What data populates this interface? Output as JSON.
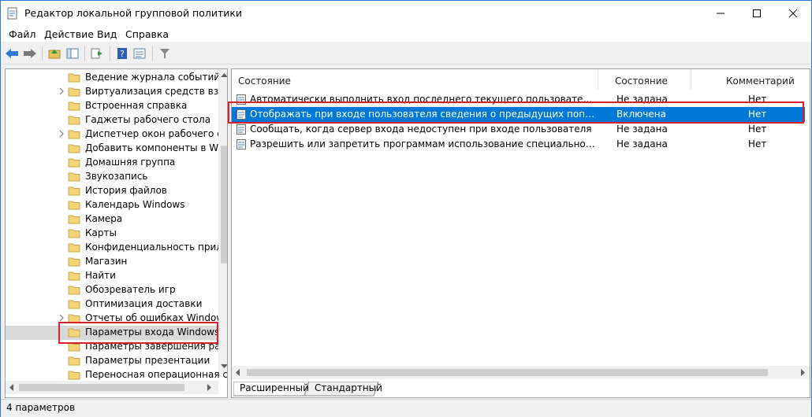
{
  "window": {
    "title": "Редактор локальной групповой политики"
  },
  "menu": [
    "Файл",
    "Действие",
    "Вид",
    "Справка"
  ],
  "tree": {
    "items": [
      {
        "label": "Ведение журнала событий",
        "expandable": false
      },
      {
        "label": "Виртуализация средств взаим",
        "expandable": true
      },
      {
        "label": "Встроенная справка",
        "expandable": false
      },
      {
        "label": "Гаджеты рабочего стола",
        "expandable": false
      },
      {
        "label": "Диспетчер окон рабочего стс",
        "expandable": true
      },
      {
        "label": "Добавить компоненты в Winc",
        "expandable": false
      },
      {
        "label": "Домашняя группа",
        "expandable": false
      },
      {
        "label": "Звукозапись",
        "expandable": false
      },
      {
        "label": "История файлов",
        "expandable": false
      },
      {
        "label": "Календарь Windows",
        "expandable": false
      },
      {
        "label": "Камера",
        "expandable": false
      },
      {
        "label": "Карты",
        "expandable": false
      },
      {
        "label": "Конфиденциальность прилож",
        "expandable": false
      },
      {
        "label": "Магазин",
        "expandable": false
      },
      {
        "label": "Найти",
        "expandable": false
      },
      {
        "label": "Обозреватель игр",
        "expandable": false
      },
      {
        "label": "Оптимизация доставки",
        "expandable": false
      },
      {
        "label": "Отчеты об ошибках Windows",
        "expandable": true
      },
      {
        "label": "Параметры входа Windows",
        "expandable": false,
        "selected": true
      },
      {
        "label": "Параметры завершения рабо",
        "expandable": false
      },
      {
        "label": "Параметры презентации",
        "expandable": false
      },
      {
        "label": "Переносная операционная с",
        "expandable": false
      }
    ]
  },
  "list": {
    "columns": {
      "name": "Состояние",
      "state": "Состояние",
      "comment": "Комментарий"
    },
    "rows": [
      {
        "name": "Автоматически выполнить вход последнего текущего пользователя после ин...",
        "state": "Не задана",
        "comment": "Нет"
      },
      {
        "name": "Отображать при входе пользователя сведения о предыдущих попытках входа",
        "state": "Включена",
        "comment": "Нет",
        "selected": true
      },
      {
        "name": "Сообщать, когда сервер входа недоступен при входе пользователя",
        "state": "Не задана",
        "comment": "Нет"
      },
      {
        "name": "Разрешить или запретить программам использование специального сочетан...",
        "state": "Не задана",
        "comment": "Нет"
      }
    ]
  },
  "tabs": [
    "Расширенный",
    "Стандартный"
  ],
  "status": "4 параметров",
  "colors": {
    "accent": "#0078d7",
    "highlight": "#d9202a"
  }
}
